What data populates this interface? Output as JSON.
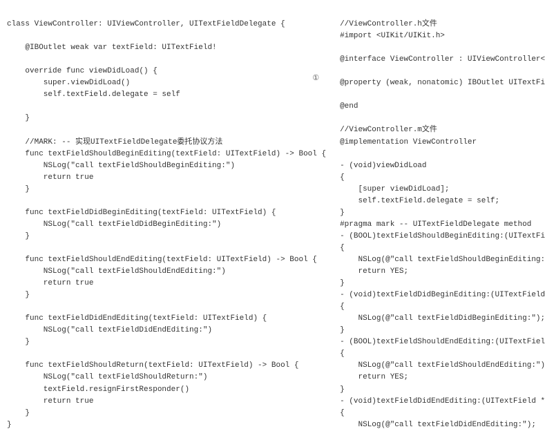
{
  "left": {
    "line01": "class ViewController: UIViewController, UITextFieldDelegate {",
    "line02": "",
    "line03": "    @IBOutlet weak var textField: UITextField!",
    "line04": "",
    "line05": "    override func viewDidLoad() {",
    "line06": "        super.viewDidLoad()",
    "line07": "        self.textField.delegate = self",
    "line08": "",
    "line09": "    }",
    "line10": "",
    "line11": "    //MARK: -- 实现UITextFieldDelegate委托协议方法",
    "line12": "    func textFieldShouldBeginEditing(textField: UITextField) -> Bool {",
    "line13": "        NSLog(\"call textFieldShouldBeginEditing:\")",
    "line14": "        return true",
    "line15": "    }",
    "line16": "",
    "line17": "    func textFieldDidBeginEditing(textField: UITextField) {",
    "line18": "        NSLog(\"call textFieldDidBeginEditing:\")",
    "line19": "    }",
    "line20": "",
    "line21": "    func textFieldShouldEndEditing(textField: UITextField) -> Bool {",
    "line22": "        NSLog(\"call textFieldShouldEndEditing:\")",
    "line23": "        return true",
    "line24": "    }",
    "line25": "",
    "line26": "    func textFieldDidEndEditing(textField: UITextField) {",
    "line27": "        NSLog(\"call textFieldDidEndEditing:\")",
    "line28": "    }",
    "line29": "",
    "line30": "    func textFieldShouldReturn(textField: UITextField) -> Bool {",
    "line31": "        NSLog(\"call textFieldShouldReturn:\")",
    "line32": "        textField.resignFirstResponder()",
    "line33": "        return true",
    "line34": "    }",
    "line35": "}"
  },
  "right": {
    "line01": "//ViewController.h文件",
    "line02": "#import <UIKit/UIKit.h>",
    "line03": "",
    "line04": "@interface ViewController : UIViewController<UITextFieldDelegate>",
    "line05": "",
    "line06": "@property (weak, nonatomic) IBOutlet UITextField *textField;",
    "line07": "",
    "line08": "@end",
    "line09": "",
    "line10": "//ViewController.m文件",
    "line11": "@implementation ViewController",
    "line12": "",
    "line13": "- (void)viewDidLoad",
    "line14": "{",
    "line15": "    [super viewDidLoad];",
    "line16": "    self.textField.delegate = self;",
    "line17": "}",
    "line18": "#pragma mark -- UITextFieldDelegate method",
    "line19": "- (BOOL)textFieldShouldBeginEditing:(UITextField *)textField",
    "line20": "{",
    "line21": "    NSLog(@\"call textFieldShouldBeginEditing:\");",
    "line22": "    return YES;",
    "line23": "}",
    "line24": "- (void)textFieldDidBeginEditing:(UITextField *)textField",
    "line25": "{",
    "line26": "    NSLog(@\"call textFieldDidBeginEditing:\");",
    "line27": "}",
    "line28": "- (BOOL)textFieldShouldEndEditing:(UITextField *)textField",
    "line29": "{",
    "line30": "    NSLog(@\"call textFieldShouldEndEditing:\");",
    "line31": "    return YES;",
    "line32": "}",
    "line33": "- (void)textFieldDidEndEditing:(UITextField *)textField",
    "line34": "{",
    "line35": "    NSLog(@\"call textFieldDidEndEditing:\");"
  },
  "annotations": {
    "left_1": "①",
    "right_1": "①"
  }
}
